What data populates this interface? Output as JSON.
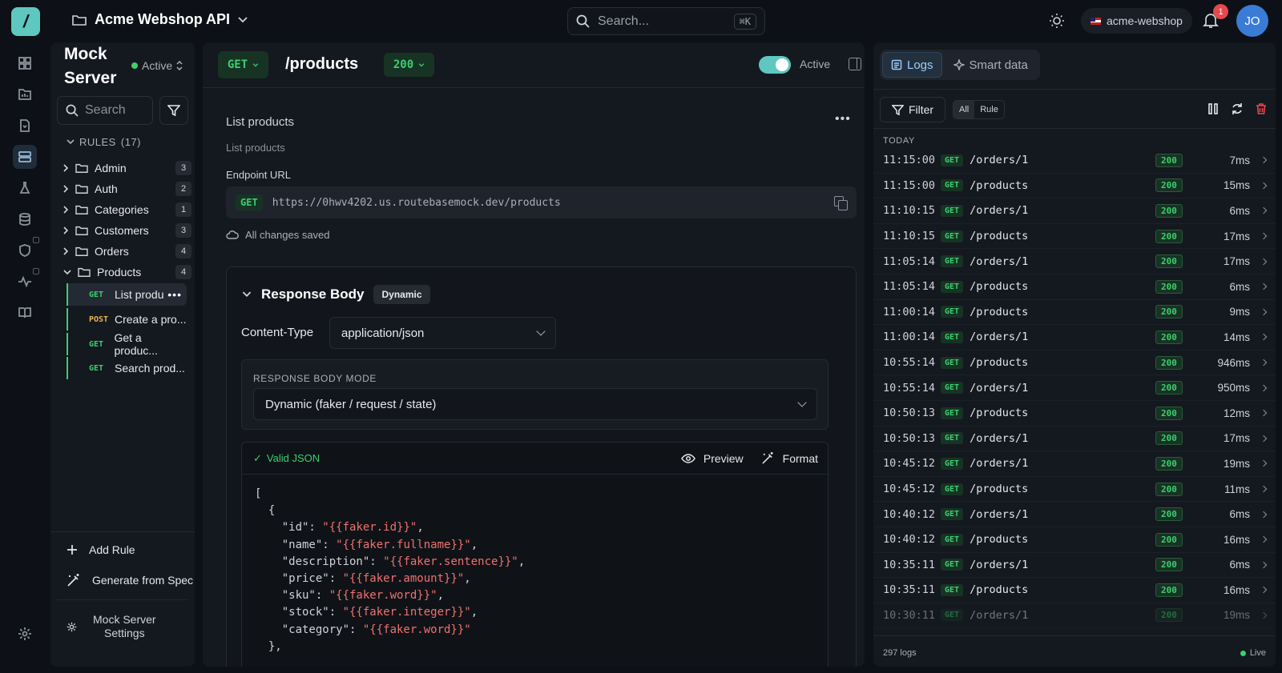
{
  "header": {
    "project_name": "Acme Webshop API",
    "search_placeholder": "Search...",
    "search_shortcut": "⌘K",
    "workspace": "acme-webshop",
    "notification_count": "1",
    "avatar_initials": "JO"
  },
  "sidebar": {
    "title_line1": "Mock",
    "title_line2": "Server",
    "status": "Active",
    "search_placeholder": "Search",
    "rules_label": "RULES",
    "rules_count": "(17)",
    "folders": [
      {
        "name": "Admin",
        "count": "3"
      },
      {
        "name": "Auth",
        "count": "2"
      },
      {
        "name": "Categories",
        "count": "1"
      },
      {
        "name": "Customers",
        "count": "3"
      },
      {
        "name": "Orders",
        "count": "4"
      },
      {
        "name": "Products",
        "count": "4"
      }
    ],
    "product_rules": [
      {
        "method": "GET",
        "name": "List produ"
      },
      {
        "method": "POST",
        "name": "Create a pro..."
      },
      {
        "method": "GET",
        "name": "Get a produc..."
      },
      {
        "method": "GET",
        "name": "Search prod..."
      }
    ],
    "add_rule": "Add Rule",
    "generate_from_spec": "Generate from Spec",
    "settings_line1": "Mock Server",
    "settings_line2": "Settings"
  },
  "main": {
    "method": "GET",
    "path": "/products",
    "status_code": "200",
    "active_label": "Active",
    "title": "List products",
    "description": "List products",
    "endpoint_label": "Endpoint URL",
    "endpoint_method": "GET",
    "endpoint_url": "https://0hwv4202.us.routebasemock.dev/products",
    "saved_status": "All changes saved",
    "response_body_title": "Response Body",
    "response_body_badge": "Dynamic",
    "content_type_label": "Content-Type",
    "content_type_value": "application/json",
    "mode_label": "RESPONSE BODY MODE",
    "mode_value": "Dynamic (faker / request / state)",
    "valid_json": "Valid JSON",
    "preview_label": "Preview",
    "format_label": "Format",
    "code_lines": [
      {
        "t": "["
      },
      {
        "t": "  {"
      },
      {
        "k": "    \"id\": ",
        "s": "\"{{faker.id}}\"",
        "e": ","
      },
      {
        "k": "    \"name\": ",
        "s": "\"{{faker.fullname}}\"",
        "e": ","
      },
      {
        "k": "    \"description\": ",
        "s": "\"{{faker.sentence}}\"",
        "e": ","
      },
      {
        "k": "    \"price\": ",
        "s": "\"{{faker.amount}}\"",
        "e": ","
      },
      {
        "k": "    \"sku\": ",
        "s": "\"{{faker.word}}\"",
        "e": ","
      },
      {
        "k": "    \"stock\": ",
        "s": "\"{{faker.integer}}\"",
        "e": ","
      },
      {
        "k": "    \"category\": ",
        "s": "\"{{faker.word}}\"",
        "e": ""
      },
      {
        "t": "  },"
      }
    ]
  },
  "logs_panel": {
    "tab_logs": "Logs",
    "tab_smart": "Smart data",
    "filter_label": "Filter",
    "seg_all": "All",
    "seg_rule": "Rule",
    "section": "TODAY",
    "rows": [
      {
        "time": "11:15:00",
        "method": "GET",
        "path": "/orders/1",
        "status": "200",
        "duration": "7ms"
      },
      {
        "time": "11:15:00",
        "method": "GET",
        "path": "/products",
        "status": "200",
        "duration": "15ms"
      },
      {
        "time": "11:10:15",
        "method": "GET",
        "path": "/orders/1",
        "status": "200",
        "duration": "6ms"
      },
      {
        "time": "11:10:15",
        "method": "GET",
        "path": "/products",
        "status": "200",
        "duration": "17ms"
      },
      {
        "time": "11:05:14",
        "method": "GET",
        "path": "/orders/1",
        "status": "200",
        "duration": "17ms"
      },
      {
        "time": "11:05:14",
        "method": "GET",
        "path": "/products",
        "status": "200",
        "duration": "6ms"
      },
      {
        "time": "11:00:14",
        "method": "GET",
        "path": "/products",
        "status": "200",
        "duration": "9ms"
      },
      {
        "time": "11:00:14",
        "method": "GET",
        "path": "/orders/1",
        "status": "200",
        "duration": "14ms"
      },
      {
        "time": "10:55:14",
        "method": "GET",
        "path": "/products",
        "status": "200",
        "duration": "946ms"
      },
      {
        "time": "10:55:14",
        "method": "GET",
        "path": "/orders/1",
        "status": "200",
        "duration": "950ms"
      },
      {
        "time": "10:50:13",
        "method": "GET",
        "path": "/products",
        "status": "200",
        "duration": "12ms"
      },
      {
        "time": "10:50:13",
        "method": "GET",
        "path": "/orders/1",
        "status": "200",
        "duration": "17ms"
      },
      {
        "time": "10:45:12",
        "method": "GET",
        "path": "/orders/1",
        "status": "200",
        "duration": "19ms"
      },
      {
        "time": "10:45:12",
        "method": "GET",
        "path": "/products",
        "status": "200",
        "duration": "11ms"
      },
      {
        "time": "10:40:12",
        "method": "GET",
        "path": "/orders/1",
        "status": "200",
        "duration": "6ms"
      },
      {
        "time": "10:40:12",
        "method": "GET",
        "path": "/products",
        "status": "200",
        "duration": "16ms"
      },
      {
        "time": "10:35:11",
        "method": "GET",
        "path": "/orders/1",
        "status": "200",
        "duration": "6ms"
      },
      {
        "time": "10:35:11",
        "method": "GET",
        "path": "/products",
        "status": "200",
        "duration": "16ms"
      },
      {
        "time": "10:30:11",
        "method": "GET",
        "path": "/orders/1",
        "status": "200",
        "duration": "19ms"
      }
    ],
    "total": "297 logs",
    "live": "Live"
  },
  "colors": {
    "accent": "#5ec8c0",
    "get": "#3ccf6e",
    "post": "#e6b450",
    "string": "#f0716e",
    "danger": "#e5484d"
  }
}
